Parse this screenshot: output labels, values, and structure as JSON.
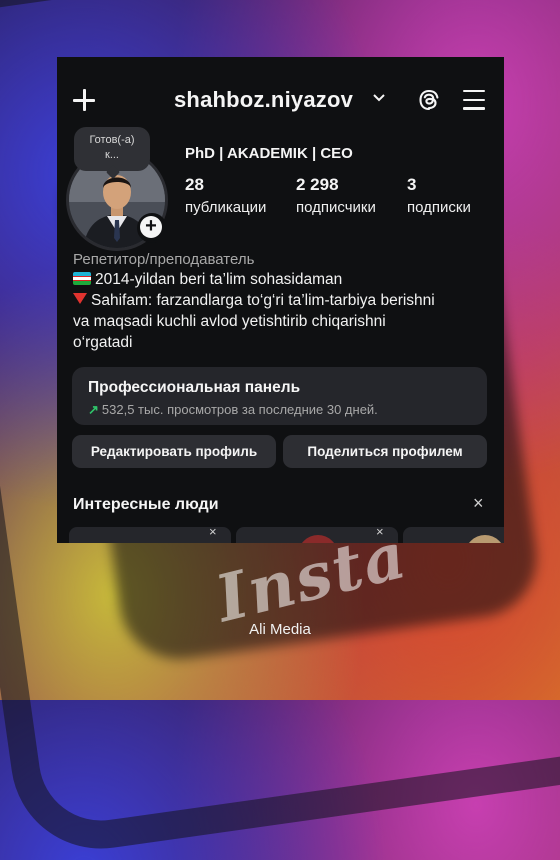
{
  "header": {
    "username": "shahboz.niyazov"
  },
  "note": {
    "text_line1": "Готов(-а)",
    "text_line2": "к..."
  },
  "profile": {
    "headline": "PhD | AKADEMIK | CEO",
    "stats": [
      {
        "value": "28",
        "label": "публикации"
      },
      {
        "value": "2 298",
        "label": "подписчики"
      },
      {
        "value": "3",
        "label": "подписки"
      }
    ],
    "category": "Репетитор/преподаватель",
    "bio": [
      "2014-yildan beri ta’lim sohasidaman",
      "Sahifam: farzandlarga to‘g‘ri ta’lim-tarbiya berishni",
      "va maqsadi kuchli avlod yetishtirib chiqarishni",
      "o‘rgatadi"
    ]
  },
  "pro_panel": {
    "title": "Профессиональная панель",
    "subtitle": "532,5 тыс. просмотров за последние 30 дней."
  },
  "buttons": {
    "edit": "Редактировать профиль",
    "share": "Поделиться профилем"
  },
  "suggestions": {
    "title": "Интересные люди",
    "close": "×",
    "card_close": "×"
  },
  "watermark": "Insta",
  "footer": "Ali Media",
  "colors": {
    "panel_bg": "#0f1012",
    "button_bg": "#2d2e33",
    "trend_green": "#2fc46a"
  }
}
